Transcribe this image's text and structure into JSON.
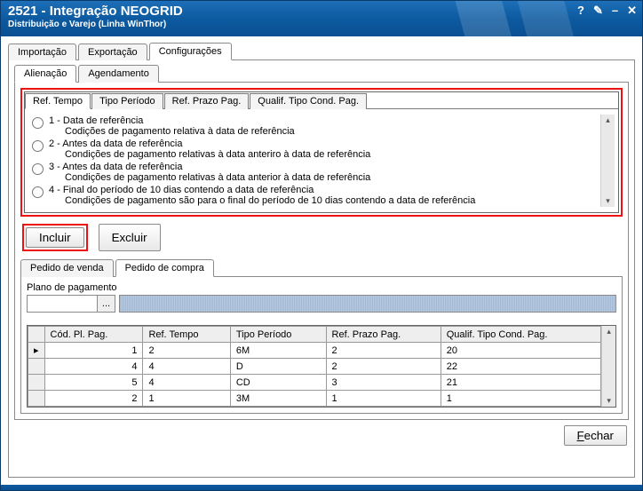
{
  "window": {
    "title": "2521 - Integração NEOGRID",
    "subtitle": "Distribuição e Varejo (Linha WinThor)"
  },
  "titlebar_icons": {
    "help": "?",
    "edit": "✎",
    "minimize": "–",
    "close": "✕"
  },
  "main_tabs": {
    "import": "Importação",
    "export": "Exportação",
    "config": "Configurações"
  },
  "config_subtabs": {
    "alienacao": "Alienação",
    "agendamento": "Agendamento"
  },
  "option_tabs": {
    "ref_tempo": "Ref. Tempo",
    "tipo_periodo": "Tipo Período",
    "ref_prazo": "Ref. Prazo Pag.",
    "qualif": "Qualif. Tipo Cond. Pag."
  },
  "options": [
    {
      "title": "1 - Data de referência",
      "desc": "Codições de pagamento relativa à data de referência"
    },
    {
      "title": "2 - Antes da data de referência",
      "desc": "Condições de pagamento relativas à data anteriro à data de referência"
    },
    {
      "title": "3 - Antes da data de referência",
      "desc": "Condições de pagamento relativas à data anterior à data de referência"
    },
    {
      "title": "4 - Final do período de 10 dias contendo a data de referência",
      "desc": "Condições de pagamento são para o final do período de 10 dias contendo a data de referência"
    }
  ],
  "buttons": {
    "incluir": "Incluir",
    "excluir": "Excluir",
    "fechar": "Fechar"
  },
  "lower_tabs": {
    "pv": "Pedido de venda",
    "pc": "Pedido de compra"
  },
  "plano_label": "Plano de pagamento",
  "picker_btn": "...",
  "grid": {
    "headers": {
      "cod": "Cód. Pl. Pag.",
      "ref": "Ref. Tempo",
      "tipo": "Tipo Período",
      "prazo": "Ref. Prazo Pag.",
      "qualif": "Qualif. Tipo Cond. Pag."
    },
    "rows": [
      {
        "cod": "1",
        "ref": "2",
        "tipo": "6M",
        "prazo": "2",
        "qualif": "20"
      },
      {
        "cod": "4",
        "ref": "4",
        "tipo": "D",
        "prazo": "2",
        "qualif": "22"
      },
      {
        "cod": "5",
        "ref": "4",
        "tipo": "CD",
        "prazo": "3",
        "qualif": "21"
      },
      {
        "cod": "2",
        "ref": "1",
        "tipo": "3M",
        "prazo": "1",
        "qualif": "1"
      }
    ]
  },
  "row_marker": "▸"
}
